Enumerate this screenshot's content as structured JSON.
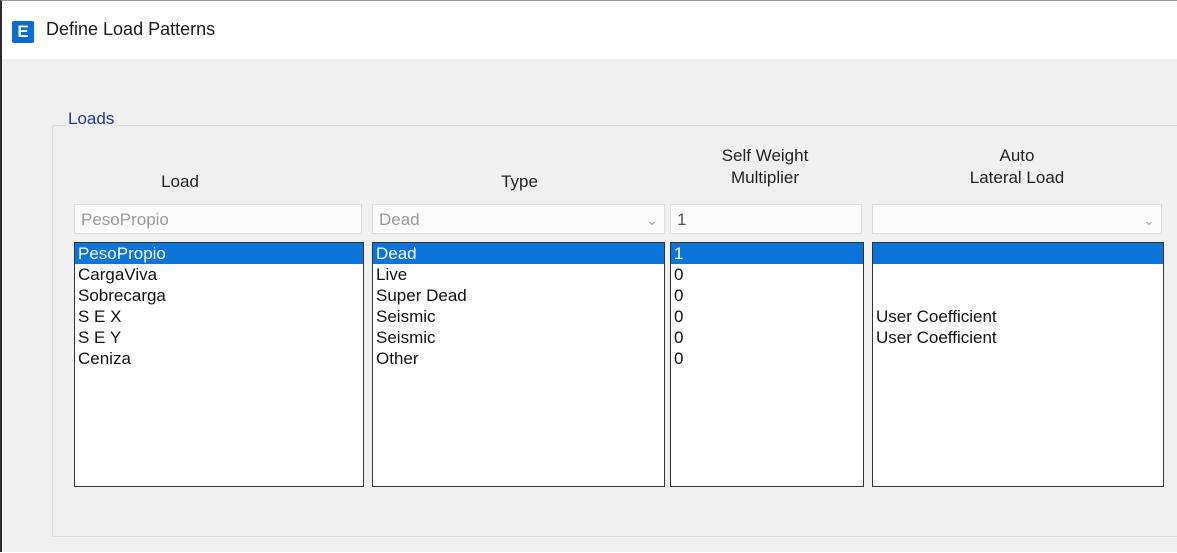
{
  "window": {
    "title": "Define Load Patterns",
    "icon_letter": "E",
    "icon_name": "etabs-app-icon"
  },
  "group": {
    "label": "Loads"
  },
  "headers": {
    "load": "Load",
    "type": "Type",
    "self_weight_line1": "Self Weight",
    "self_weight_line2": "Multiplier",
    "auto_line1": "Auto",
    "auto_line2": "Lateral Load"
  },
  "edit_row": {
    "load": "PesoPropio",
    "type": "Dead",
    "self_weight": "1",
    "auto": ""
  },
  "lists": {
    "loads": [
      "PesoPropio",
      "CargaViva",
      "Sobrecarga",
      "S E X",
      "S E Y",
      "Ceniza"
    ],
    "types": [
      "Dead",
      "Live",
      "Super Dead",
      "Seismic",
      "Seismic",
      "Other"
    ],
    "multipliers": [
      "1",
      "0",
      "0",
      "0",
      "0",
      "0"
    ],
    "auto_lateral": [
      "",
      "",
      "",
      "User Coefficient",
      "User Coefficient",
      ""
    ]
  },
  "selected_index": 0,
  "colors": {
    "selection": "#0a74da",
    "group_label": "#1f3a9a"
  }
}
